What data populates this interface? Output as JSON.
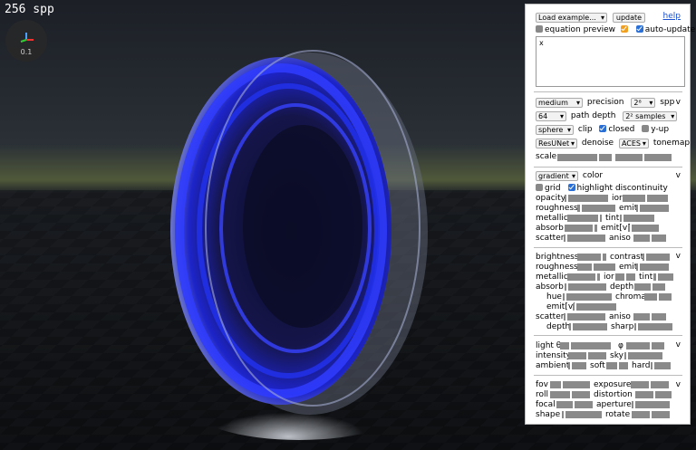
{
  "viewport": {
    "spp_counter": "256 spp",
    "zoom": "0.1"
  },
  "panel": {
    "top": {
      "load_example": "Load example...",
      "update": "update",
      "help": "help",
      "equation_preview": "equation preview",
      "auto_update": "auto-update",
      "equation": "x"
    },
    "render": {
      "precision_value": "medium",
      "precision": "precision",
      "spp_value": "2⁸",
      "spp": "spp",
      "depth_value": "64",
      "path_depth": "path depth",
      "samples_value": "2² samples",
      "clip_value": "sphere",
      "clip": "clip",
      "closed": "closed",
      "yup": "y-up",
      "denoise_value": "ResUNet",
      "denoise": "denoise",
      "tonemap_value": "ACES",
      "tonemap": "tonemap",
      "scale": "scale",
      "collapse": "v"
    },
    "color": {
      "mode_value": "gradient",
      "color": "color",
      "grid": "grid",
      "highlight": "highlight discontinuity",
      "labels": [
        "opacity",
        "ior",
        "roughness",
        "emit",
        "metallic",
        "tint",
        "absorb",
        "emit[v]",
        "scatter",
        "aniso"
      ],
      "collapse": "v"
    },
    "adjust": {
      "labels": [
        "brightness",
        "contrast",
        "roughness",
        "emit",
        "metallic",
        "ior",
        "tint",
        "absorb",
        "depth",
        "hue",
        "chroma",
        "emit[v]",
        "scatter",
        "aniso",
        "depth",
        "sharp"
      ],
      "collapse": "v"
    },
    "light": {
      "labels": [
        "light θ",
        "φ",
        "intensity",
        "sky",
        "ambient",
        "soft",
        "hard"
      ],
      "collapse": "v"
    },
    "camera": {
      "labels": [
        "fov",
        "exposure",
        "roll",
        "distortion",
        "focal",
        "aperture",
        "shape",
        "rotate"
      ],
      "collapse": "v"
    }
  }
}
